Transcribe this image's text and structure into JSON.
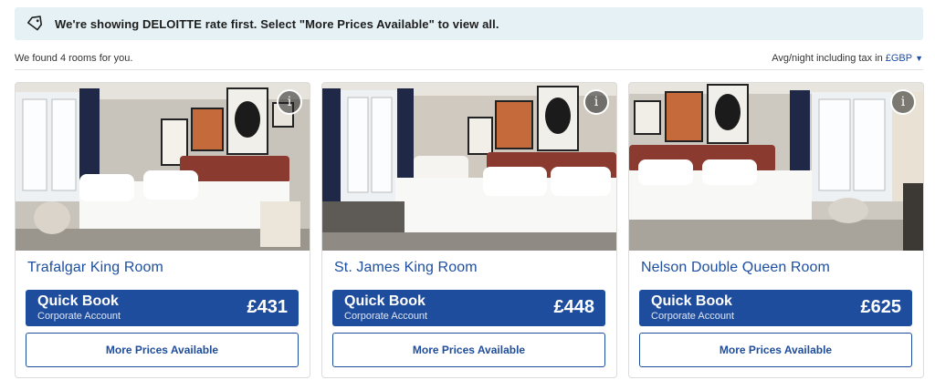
{
  "banner": {
    "icon": "tag-icon",
    "message": "We're showing DELOITTE rate first. Select \"More Prices Available\" to view all."
  },
  "summary": {
    "found_text": "We found 4 rooms for you.",
    "rate_note": "Avg/night including tax in",
    "currency": "£GBP",
    "currency_caret": "▼"
  },
  "rooms": [
    {
      "name": "Trafalgar King Room",
      "info_label": "i",
      "quick_book_title": "Quick Book",
      "quick_book_subtitle": "Corporate Account",
      "price": "£431",
      "more_prices_label": "More Prices Available"
    },
    {
      "name": "St. James King Room",
      "info_label": "i",
      "quick_book_title": "Quick Book",
      "quick_book_subtitle": "Corporate Account",
      "price": "£448",
      "more_prices_label": "More Prices Available"
    },
    {
      "name": "Nelson Double Queen Room",
      "info_label": "i",
      "quick_book_title": "Quick Book",
      "quick_book_subtitle": "Corporate Account",
      "price": "£625",
      "more_prices_label": "More Prices Available"
    }
  ],
  "colors": {
    "brand_blue": "#1f4d9d",
    "banner_bg": "#e5f1f4",
    "link_blue": "#1d4fa0"
  }
}
